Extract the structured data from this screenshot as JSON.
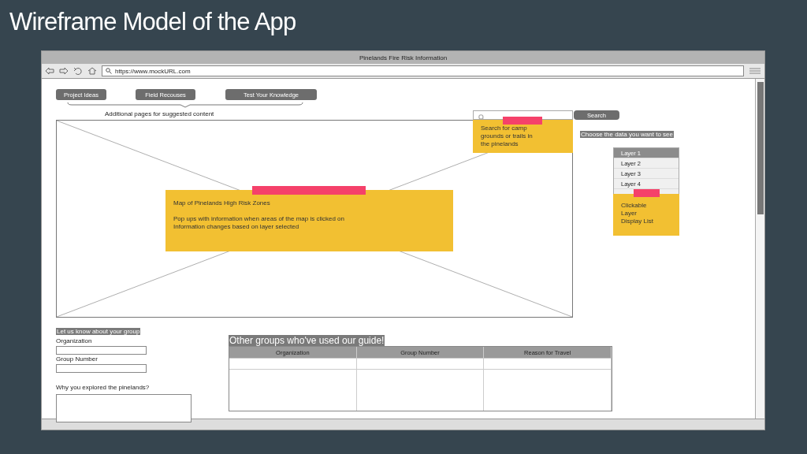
{
  "slide_title": "Wireframe Model of the App",
  "browser": {
    "title": "Pinelands Fire Risk Information",
    "url": "https://www.mockURL.com"
  },
  "nav_buttons": [
    "Project Ideas",
    "Field Recouses",
    "Test Your Knowledge"
  ],
  "nav_caption": "Additional pages for suggested content",
  "search": {
    "button": "Search"
  },
  "notes": [
    {
      "kind": "search",
      "paragraphs": [
        [
          "Search for camp",
          "grounds or trails in",
          "the pinelands"
        ]
      ]
    },
    {
      "kind": "map",
      "paragraphs": [
        [
          "Map of Pinelands High Risk Zones"
        ],
        [
          "Pop ups with information when areas of the map is clicked on",
          "Information changes based on layer selected"
        ]
      ]
    },
    {
      "kind": "layers",
      "paragraphs": [
        [
          "Clickable",
          "Layer",
          "Display List"
        ]
      ]
    }
  ],
  "layer_heading": "Choose the data you want to see",
  "layers": [
    {
      "label": "Layer 1",
      "selected": true
    },
    {
      "label": "Layer 2",
      "selected": false
    },
    {
      "label": "Layer 3",
      "selected": false
    },
    {
      "label": "Layer 4",
      "selected": false
    }
  ],
  "form": {
    "heading": "Let us know about your group",
    "fields": [
      {
        "label": "Organization",
        "kind": "line"
      },
      {
        "label": "Group Number",
        "kind": "line"
      },
      {
        "label": "Why you explored the pinelands?",
        "kind": "area"
      }
    ]
  },
  "table": {
    "heading": "Other groups who've used our guide!",
    "columns": [
      "Organization",
      "Group Number",
      "Reason for Travel"
    ]
  }
}
